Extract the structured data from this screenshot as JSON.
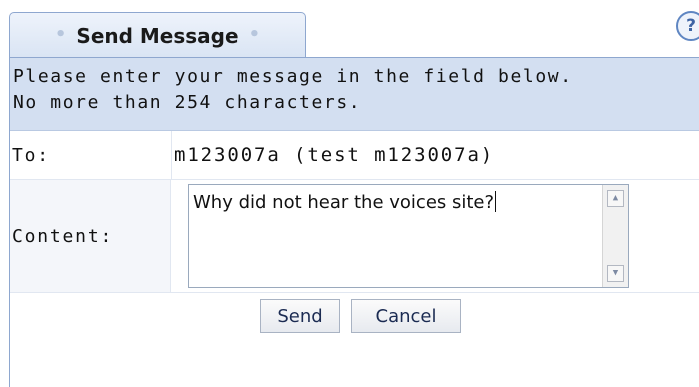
{
  "tab": {
    "label": "Send Message",
    "bullet_left": "•",
    "bullet_right": "•"
  },
  "help": {
    "glyph": "?"
  },
  "instructions": {
    "line1": "Please enter your message in the field below.",
    "line2": "No more than 254 characters."
  },
  "form": {
    "to_label": "To:",
    "to_value": "m123007a (test m123007a)",
    "content_label": "Content:",
    "content_value": "Why did not hear the voices site?"
  },
  "buttons": {
    "send": "Send",
    "cancel": "Cancel"
  },
  "colors": {
    "panel_background": "#d3dff1",
    "border": "#8ea7cf",
    "button_text": "#1b2b52"
  }
}
